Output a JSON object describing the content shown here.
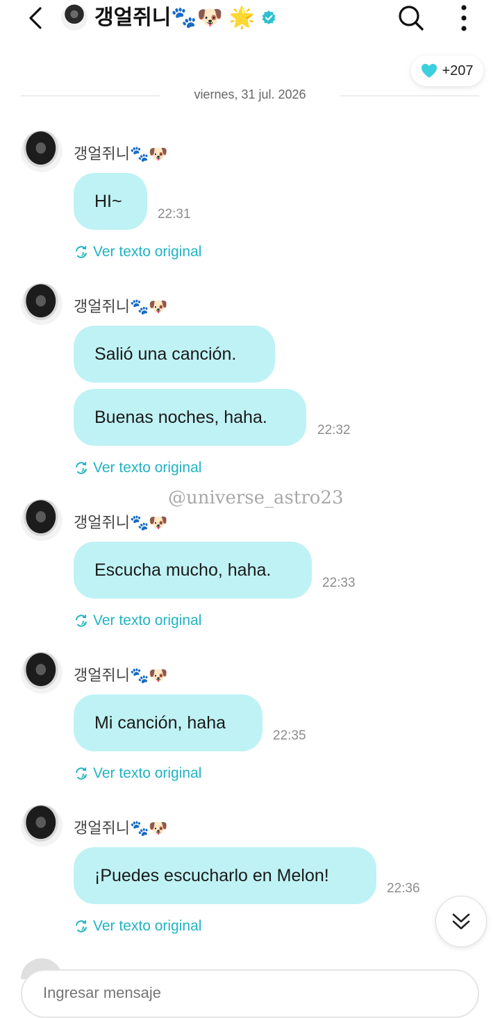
{
  "header": {
    "title": "갱얼쥐니🐾🐶 🌟",
    "icons": {
      "back": "chevron-left-icon",
      "verified": "verified-badge-icon",
      "search": "search-icon",
      "menu": "more-vertical-icon"
    }
  },
  "like_badge": {
    "count": "+207",
    "icon": "heart-icon",
    "color": "#3ccfdc"
  },
  "date_divider": "viernes, 31 jul. 2026",
  "messages": [
    {
      "sender": "갱얼쥐니🐾🐶",
      "bubbles": [
        "HI~"
      ],
      "time": "22:31",
      "translate_label": "Ver texto original"
    },
    {
      "sender": "갱얼쥐니🐾🐶",
      "bubbles": [
        "Salió una canción.",
        "Buenas noches, haha."
      ],
      "time": "22:32",
      "translate_label": "Ver texto original"
    },
    {
      "sender": "갱얼쥐니🐾🐶",
      "bubbles": [
        "Escucha mucho, haha."
      ],
      "time": "22:33",
      "translate_label": "Ver texto original"
    },
    {
      "sender": "갱얼쥐니🐾🐶",
      "bubbles": [
        "Mi canción, haha"
      ],
      "time": "22:35",
      "translate_label": "Ver texto original"
    },
    {
      "sender": "갱얼쥐니🐾🐶",
      "bubbles": [
        "¡Puedes escucharlo en Melon!"
      ],
      "time": "22:36",
      "translate_label": "Ver texto original"
    }
  ],
  "watermark": "@universe_astro23",
  "input": {
    "placeholder": "Ingresar mensaje"
  },
  "colors": {
    "bubble": "#bff2f4",
    "accent": "#1fb3c4",
    "verified": "#2bc0d0"
  }
}
